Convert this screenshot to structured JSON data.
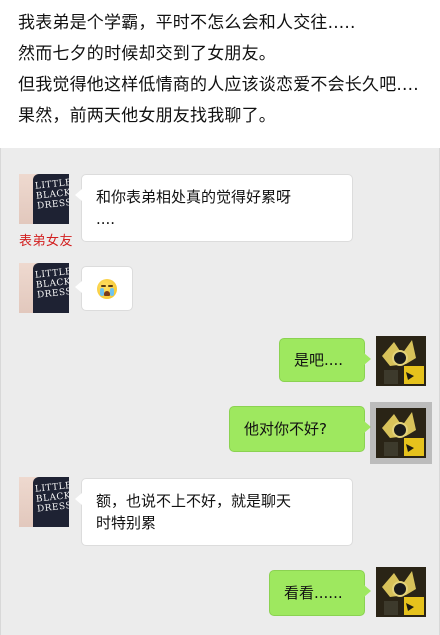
{
  "story": {
    "lines": [
      "我表弟是个学霸，平时不怎么会和人交往.....",
      "然而七夕的时候却交到了女朋友。",
      "但我觉得他这样低情商的人应该谈恋爱不会长久吧....",
      "果然，前两天他女朋友找我聊了。"
    ]
  },
  "chat": {
    "sender_name": "表弟女友",
    "avatar_print_text": "LITTLE BLACK DRESS",
    "messages": [
      {
        "side": "in",
        "text_line1": "和你表弟相处真的觉得好累呀",
        "text_line2": "...."
      },
      {
        "side": "in",
        "emoji": "crying-face-icon"
      },
      {
        "side": "out",
        "text": "是吧...."
      },
      {
        "side": "out",
        "text": "他对你不好?"
      },
      {
        "side": "in",
        "text_line1": "额，也说不上不好，就是聊天",
        "text_line2": "时特别累"
      },
      {
        "side": "out",
        "text": "看看......"
      }
    ]
  },
  "colors": {
    "outgoing_bubble": "#9ee85f",
    "incoming_bubble": "#ffffff",
    "chat_background": "#ececec",
    "sender_name": "#d21f1f"
  }
}
